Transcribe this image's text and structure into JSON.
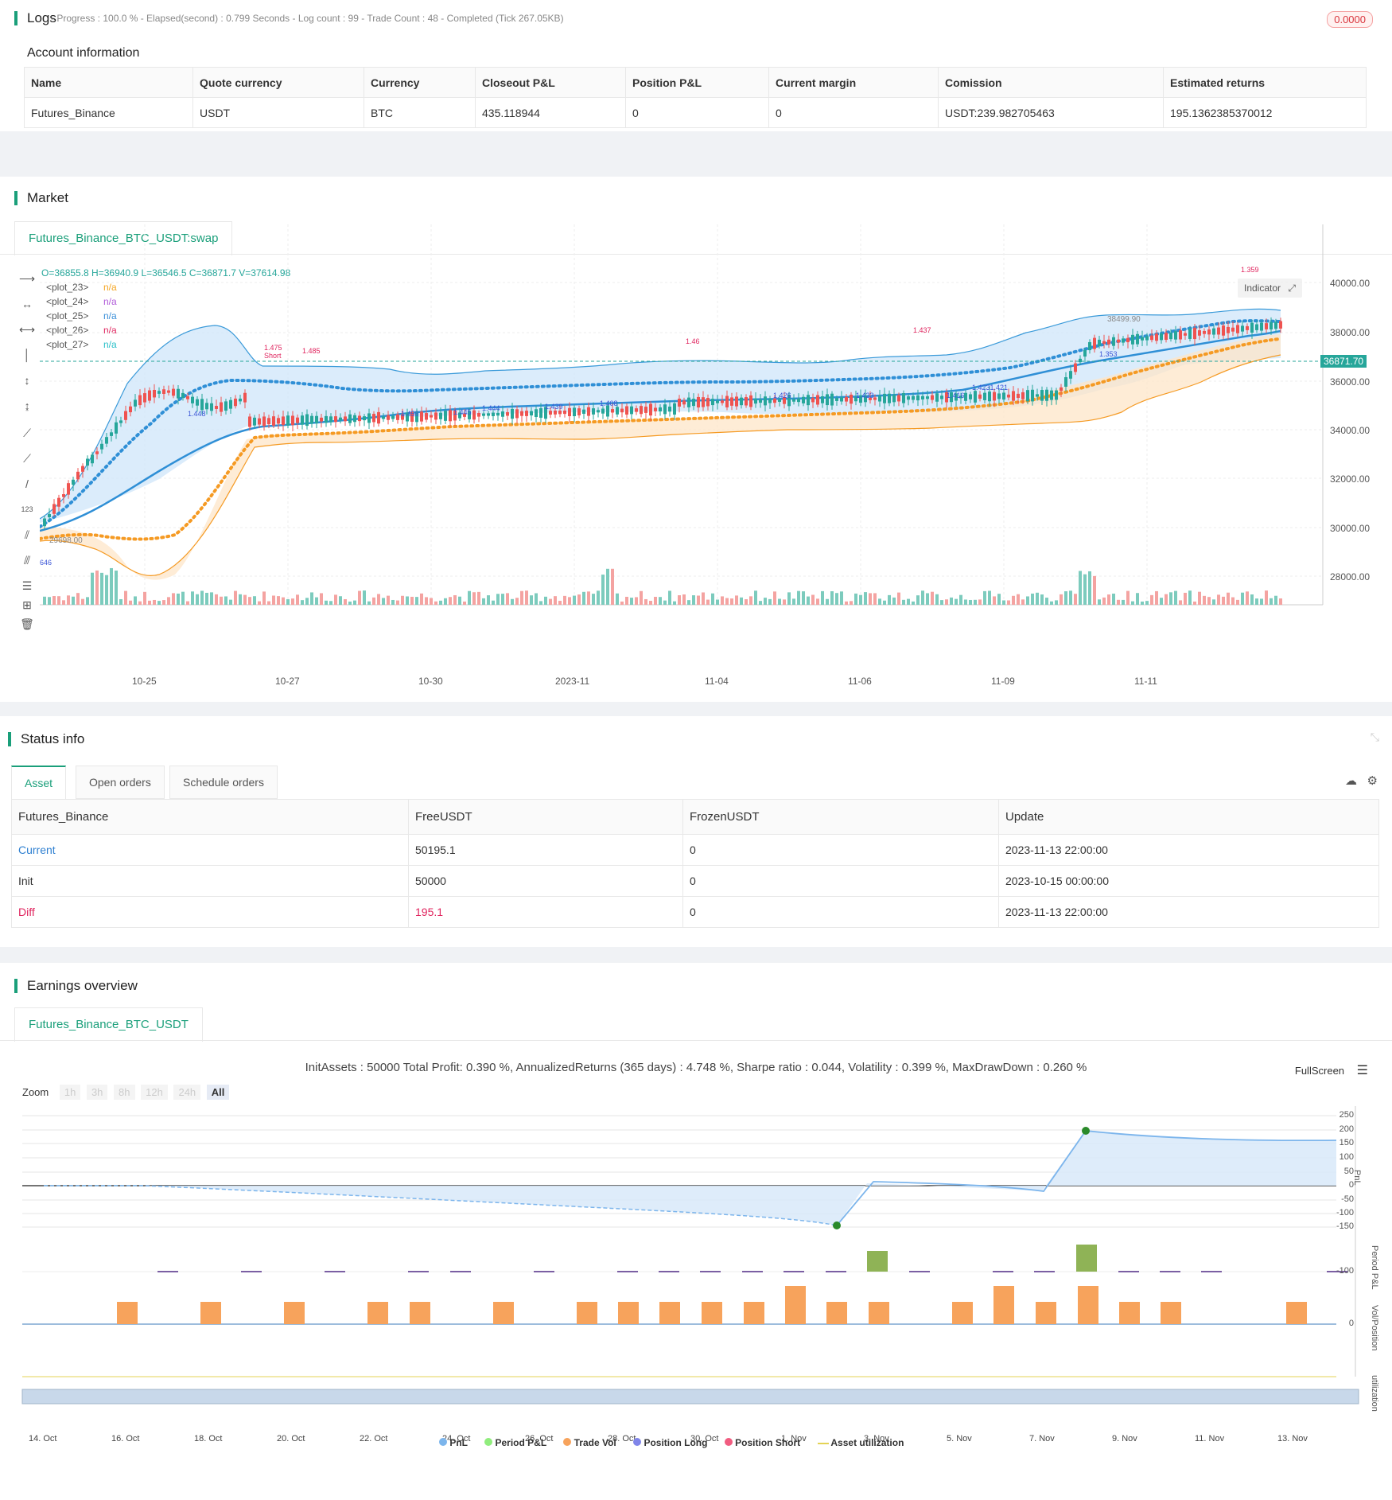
{
  "logs": {
    "title": "Logs",
    "status": "- Progress : 100.0 % - Elapsed(second) : 0.799 Seconds - Log count : 99 - Trade Count : 48 - Completed (Tick 267.05KB)",
    "badge": "0.0000"
  },
  "account": {
    "title": "Account information",
    "headers": [
      "Name",
      "Quote currency",
      "Currency",
      "Closeout P&L",
      "Position P&L",
      "Current margin",
      "Comission",
      "Estimated returns"
    ],
    "row": [
      "Futures_Binance",
      "USDT",
      "BTC",
      "435.118944",
      "0",
      "0",
      "USDT:239.982705463",
      "195.1362385370012"
    ]
  },
  "market": {
    "title": "Market",
    "tab": "Futures_Binance_BTC_USDT:swap",
    "ohlc": "O=36855.8 H=36940.9 L=36546.5 C=36871.7 V=37614.98",
    "plots": [
      {
        "name": "<plot_23>",
        "value": "n/a",
        "color": "#f5a623"
      },
      {
        "name": "<plot_24>",
        "value": "n/a",
        "color": "#b05ad8"
      },
      {
        "name": "<plot_25>",
        "value": "n/a",
        "color": "#3a8fd9"
      },
      {
        "name": "<plot_26>",
        "value": "n/a",
        "color": "#e0245e"
      },
      {
        "name": "<plot_27>",
        "value": "n/a",
        "color": "#2bc0c9"
      }
    ],
    "indicator_label": "Indicator",
    "y_ticks": [
      "40000.00",
      "38000.00",
      "36000.00",
      "34000.00",
      "32000.00",
      "30000.00",
      "28000.00"
    ],
    "x_ticks": [
      "10-25",
      "10-27",
      "10-30",
      "2023-11",
      "11-04",
      "11-06",
      "11-09",
      "11-11"
    ],
    "price_tag": "36871.70",
    "high_mark": "38499.90",
    "low_mark": "29698.00",
    "annotations": [
      {
        "text": "1.475",
        "kind": "short"
      },
      {
        "text": "Short",
        "kind": "short"
      },
      {
        "text": "1.485",
        "kind": "short"
      },
      {
        "text": "1.46",
        "kind": "short"
      },
      {
        "text": "1.437",
        "kind": "short"
      },
      {
        "text": "1.359",
        "kind": "short"
      },
      {
        "text": "1.448",
        "kind": "long"
      },
      {
        "text": "1.458",
        "kind": "long"
      },
      {
        "text": "1.445",
        "kind": "long"
      },
      {
        "text": "1.444",
        "kind": "long"
      },
      {
        "text": "1.439",
        "kind": "long"
      },
      {
        "text": "1.408",
        "kind": "long"
      },
      {
        "text": "1.426",
        "kind": "long"
      },
      {
        "text": "1.423",
        "kind": "long"
      },
      {
        "text": "1.416",
        "kind": "long"
      },
      {
        "text": "1.4231.421",
        "kind": "long"
      },
      {
        "text": "1.353",
        "kind": "long"
      },
      {
        "text": "646",
        "kind": "long"
      }
    ]
  },
  "status": {
    "title": "Status info",
    "tabs": [
      "Asset",
      "Open orders",
      "Schedule orders"
    ],
    "headers": [
      "Futures_Binance",
      "FreeUSDT",
      "FrozenUSDT",
      "Update"
    ],
    "rows": [
      [
        "Current",
        "50195.1",
        "0",
        "2023-11-13 22:00:00"
      ],
      [
        "Init",
        "50000",
        "0",
        "2023-10-15 00:00:00"
      ],
      [
        "Diff",
        "195.1",
        "0",
        "2023-11-13 22:00:00"
      ]
    ]
  },
  "earnings": {
    "title": "Earnings overview",
    "tab": "Futures_Binance_BTC_USDT",
    "summary": "InitAssets : 50000 Total Profit: 0.390 %, AnnualizedReturns (365 days) : 4.748 %, Sharpe ratio : 0.044, Volatility : 0.399 %, MaxDrawDown : 0.260 %",
    "fullscreen": "FullScreen",
    "zoom_label": "Zoom",
    "zoom_options": [
      "1h",
      "3h",
      "8h",
      "12h",
      "24h",
      "All"
    ],
    "pnl_ticks": [
      "250",
      "200",
      "150",
      "100",
      "50",
      "0",
      "-50",
      "-100",
      "-150"
    ],
    "period_tick": "-100",
    "vol_tick": "0",
    "axis_labels": [
      "PnL",
      "Period P&L",
      "Vol/Position",
      "utilization"
    ],
    "x_ticks": [
      "14. Oct",
      "16. Oct",
      "18. Oct",
      "20. Oct",
      "22. Oct",
      "24. Oct",
      "26. Oct",
      "28. Oct",
      "30. Oct",
      "1. Nov",
      "3. Nov",
      "5. Nov",
      "7. Nov",
      "9. Nov",
      "11. Nov",
      "13. Nov"
    ],
    "legend": [
      {
        "label": "PnL",
        "color": "#7cb5ec"
      },
      {
        "label": "Period P&L",
        "color": "#90ed7d"
      },
      {
        "label": "Trade Vol",
        "color": "#f7a35c"
      },
      {
        "label": "Position Long",
        "color": "#8085e9"
      },
      {
        "label": "Position Short",
        "color": "#f15c80"
      },
      {
        "label": "Asset utilization",
        "color": "#e4d354"
      }
    ]
  },
  "colors": {
    "accent": "#1a9f7a",
    "up": "#26a69a",
    "down": "#ef5350",
    "blue_band": "#3a9ad9",
    "orange_band": "#f59a23",
    "marker": "#c026d3"
  }
}
